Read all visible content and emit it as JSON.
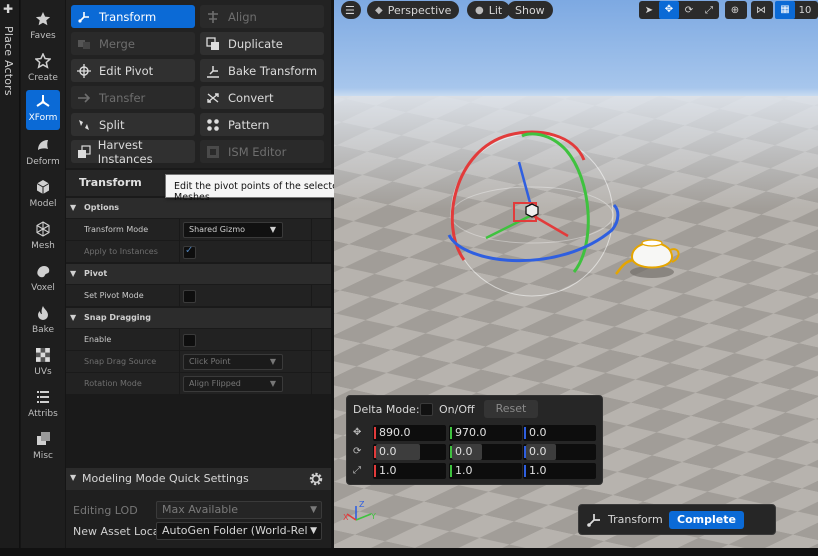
{
  "place_actors": {
    "label": "Place Actors"
  },
  "categories": [
    {
      "label": "Faves",
      "icon": "star-icon"
    },
    {
      "label": "Create",
      "icon": "create-star-icon"
    },
    {
      "label": "XForm",
      "icon": "xform-icon",
      "active": true
    },
    {
      "label": "Deform",
      "icon": "deform-icon"
    },
    {
      "label": "Model",
      "icon": "cube-icon"
    },
    {
      "label": "Mesh",
      "icon": "mesh-icon"
    },
    {
      "label": "Voxel",
      "icon": "voxel-icon"
    },
    {
      "label": "Bake",
      "icon": "flame-icon"
    },
    {
      "label": "UVs",
      "icon": "checker-icon"
    },
    {
      "label": "Attribs",
      "icon": "list-icon"
    },
    {
      "label": "Misc",
      "icon": "misc-icon"
    }
  ],
  "tools": [
    {
      "label": "Transform",
      "icon": "transform-icon",
      "state": "active"
    },
    {
      "label": "Align",
      "icon": "align-icon",
      "state": "disabled"
    },
    {
      "label": "Merge",
      "icon": "merge-icon",
      "state": "disabled"
    },
    {
      "label": "Duplicate",
      "icon": "duplicate-icon",
      "state": "normal"
    },
    {
      "label": "Edit Pivot",
      "icon": "pivot-icon",
      "state": "normal"
    },
    {
      "label": "Bake Transform",
      "icon": "bake-transform-icon",
      "state": "normal"
    },
    {
      "label": "Transfer",
      "icon": "arrow-right-icon",
      "state": "disabled"
    },
    {
      "label": "Convert",
      "icon": "convert-icon",
      "state": "normal"
    },
    {
      "label": "Split",
      "icon": "split-icon",
      "state": "normal"
    },
    {
      "label": "Pattern",
      "icon": "pattern-icon",
      "state": "normal"
    },
    {
      "label": "Harvest Instances",
      "icon": "harvest-icon",
      "state": "normal"
    },
    {
      "label": "ISM Editor",
      "icon": "ism-icon",
      "state": "disabled"
    }
  ],
  "details": {
    "title": "Transform",
    "tooltip": "Edit the pivot points of the selected Meshes",
    "sections": {
      "options": "Options",
      "pivot": "Pivot",
      "snap": "Snap Dragging"
    },
    "transform_mode_label": "Transform Mode",
    "transform_mode_value": "Shared Gizmo",
    "apply_instances_label": "Apply to Instances",
    "apply_instances_checked": true,
    "set_pivot_mode_label": "Set Pivot Mode",
    "enable_label": "Enable",
    "snap_source_label": "Snap Drag Source",
    "snap_source_value": "Click Point",
    "rotation_mode_label": "Rotation Mode",
    "rotation_mode_value": "Align Flipped"
  },
  "quick_settings": {
    "title": "Modeling Mode Quick Settings",
    "editing_lod_label": "Editing LOD",
    "editing_lod_value": "Max Available",
    "new_asset_label": "New Asset Locat",
    "new_asset_value": "AutoGen Folder (World-Rela"
  },
  "viewport": {
    "perspective": "Perspective",
    "lit": "Lit",
    "show": "Show",
    "grid_snap_value": "10"
  },
  "delta": {
    "mode_label": "Delta Mode:",
    "onoff_label": "On/Off",
    "reset_label": "Reset",
    "location": [
      "890.0",
      "970.0",
      "0.0"
    ],
    "rotation": [
      "0.0",
      "0.0",
      "0.0"
    ],
    "scale": [
      "1.0",
      "1.0",
      "1.0"
    ]
  },
  "accept": {
    "label": "Transform",
    "complete": "Complete"
  },
  "colors": {
    "accent": "#0b6ad6",
    "axis_x": "#e23b3b",
    "axis_y": "#3fc23f",
    "axis_z": "#2f5fe0"
  }
}
